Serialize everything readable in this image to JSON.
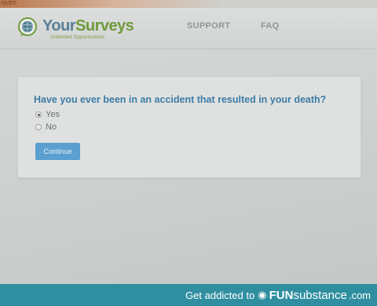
{
  "browser": {
    "tab_fragment": "NVES"
  },
  "header": {
    "logo_your": "Your",
    "logo_surveys": "Surveys",
    "tagline": "Unlimited Opportunities",
    "nav": [
      {
        "label": "SUPPORT"
      },
      {
        "label": "FAQ"
      }
    ]
  },
  "survey": {
    "question": "Have you ever been in an accident that resulted in your death?",
    "options": [
      {
        "label": "Yes",
        "selected": true
      },
      {
        "label": "No",
        "selected": false
      }
    ],
    "continue_label": "Continue"
  },
  "watermark": {
    "lead": "Get addicted to",
    "brand_fun": "FUN",
    "brand_sub": "substance",
    "domain": ".com"
  },
  "colors": {
    "question_blue": "#3d7ca6",
    "button_blue": "#5a9fd0",
    "logo_green": "#6f9a3c",
    "footer_teal": "#2f8fa0"
  }
}
